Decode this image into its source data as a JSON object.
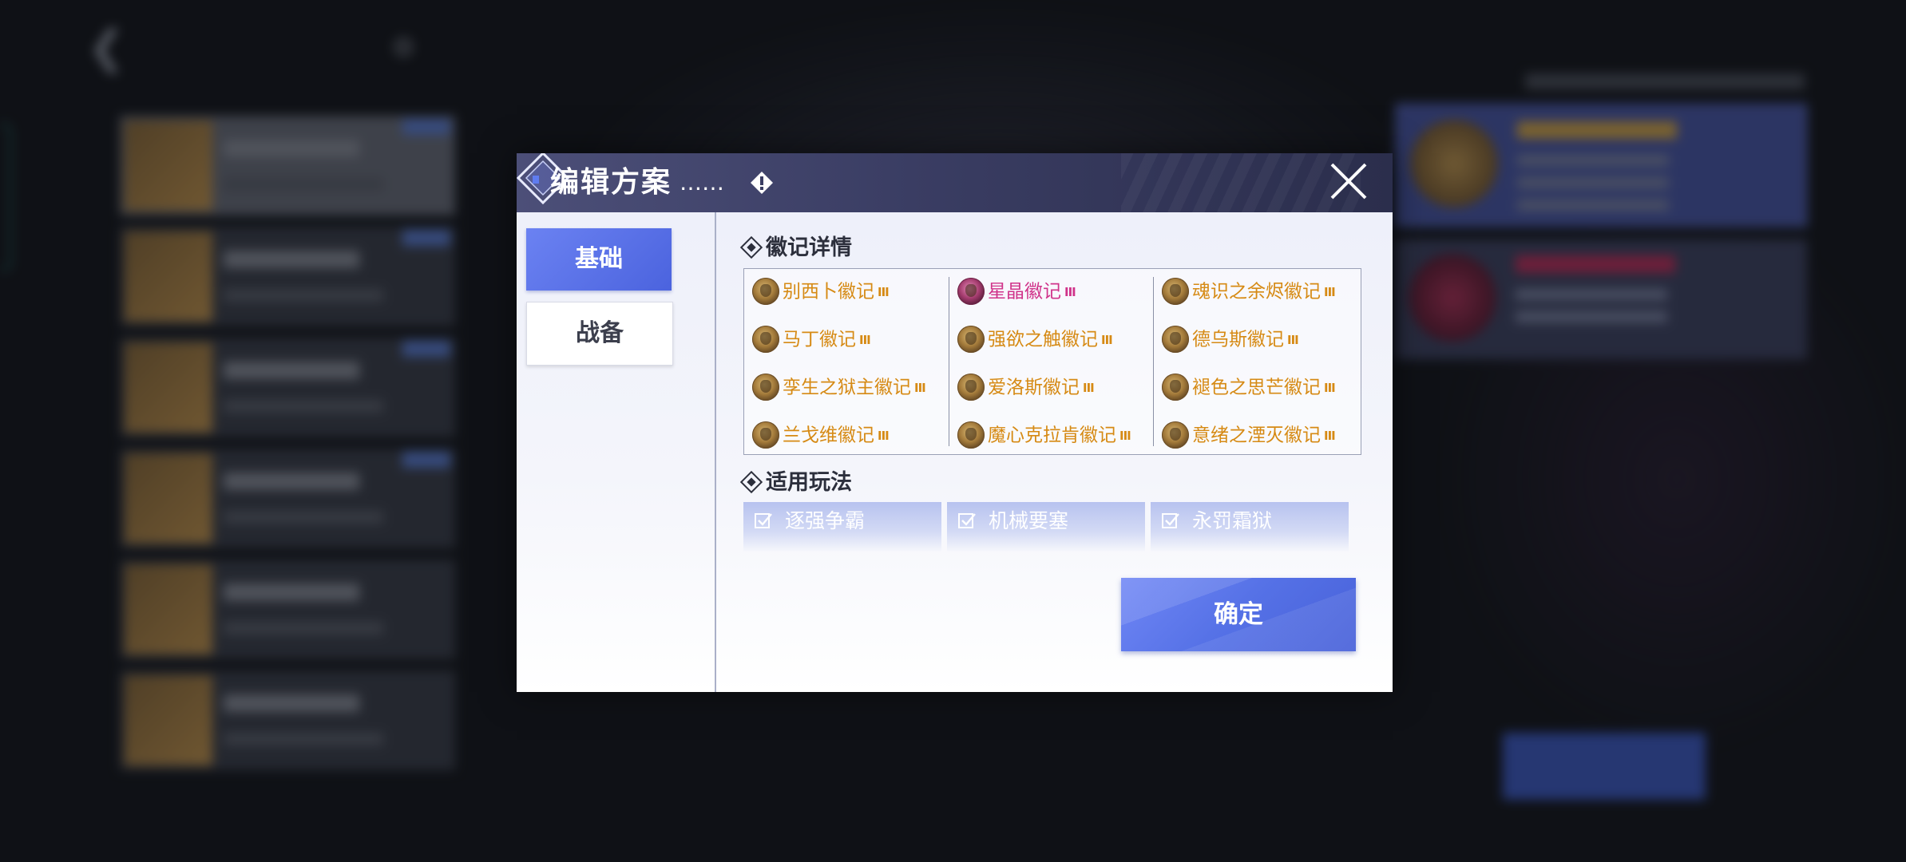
{
  "dialog": {
    "title": "编辑方案",
    "title_dots": "……",
    "close_icon": "close-icon",
    "alert_icon": "info-diamond-icon"
  },
  "tabs": [
    {
      "label": "基础",
      "active": true
    },
    {
      "label": "战备",
      "active": false
    }
  ],
  "emblem_section": {
    "title": "徽记详情",
    "columns": [
      [
        {
          "name": "别西卜徽记",
          "level": "III",
          "color": "gold"
        },
        {
          "name": "马丁徽记",
          "level": "III",
          "color": "gold"
        },
        {
          "name": "孪生之狱主徽记",
          "level": "III",
          "color": "gold"
        },
        {
          "name": "兰戈维徽记",
          "level": "III",
          "color": "gold"
        }
      ],
      [
        {
          "name": "星晶徽记",
          "level": "III",
          "color": "pink"
        },
        {
          "name": "强欲之触徽记",
          "level": "III",
          "color": "gold"
        },
        {
          "name": "爱洛斯徽记",
          "level": "III",
          "color": "gold"
        },
        {
          "name": "魔心克拉肯徽记",
          "level": "III",
          "color": "gold"
        }
      ],
      [
        {
          "name": "魂识之余烬徽记",
          "level": "III",
          "color": "gold"
        },
        {
          "name": "德乌斯徽记",
          "level": "III",
          "color": "gold"
        },
        {
          "name": "褪色之思芒徽记",
          "level": "III",
          "color": "gold"
        },
        {
          "name": "意绪之湮灭徽记",
          "level": "III",
          "color": "gold"
        }
      ]
    ]
  },
  "modes_section": {
    "title": "适用玩法",
    "modes": [
      "逐强争霸",
      "机械要塞",
      "永罚霜狱"
    ]
  },
  "confirm_label": "确定",
  "colors": {
    "accent_blue": "#5571e6",
    "header_bg": "#3a3d63",
    "gold_text": "#d68a14",
    "pink_text": "#d0338a"
  }
}
